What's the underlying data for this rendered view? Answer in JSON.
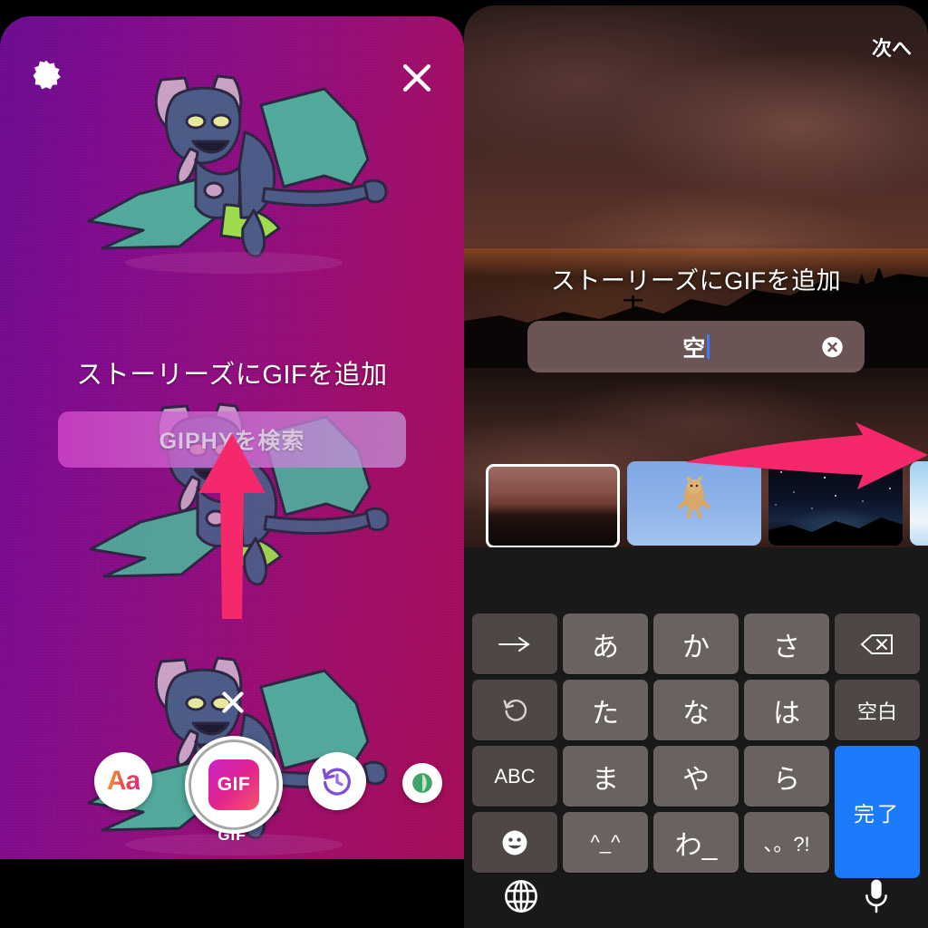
{
  "left_panel": {
    "gear_icon": "gear-icon",
    "close_icon": "close-icon",
    "headline": "ストーリーズにGIFを追加",
    "search_button_label": "GIPHYを検索",
    "sticker_delete_icon": "close-icon",
    "tools": [
      {
        "name": "text-tool",
        "icon": "Aa",
        "label": "Aa"
      },
      {
        "name": "gif-tool",
        "icon": "gif-chip",
        "label": "GIF",
        "selected": true
      },
      {
        "name": "history-tool",
        "icon": "history-clock-icon",
        "label": ""
      },
      {
        "name": "effects-tool",
        "icon": "leaf-icon",
        "label": ""
      }
    ],
    "bottom_label": "GIF",
    "annotation_arrow": "arrow-up",
    "colors": {
      "gradient_start": "#6b0a8f",
      "gradient_end": "#a50b56",
      "arrow": "#f4286a"
    }
  },
  "right_panel": {
    "next_button_label": "次へ",
    "headline": "ストーリーズにGIFを追加",
    "search": {
      "value": "空",
      "placeholder": "GIPHYを検索",
      "clear_icon": "clear-circle-icon"
    },
    "thumbnails": [
      {
        "name": "thumb-sunset",
        "selected": true
      },
      {
        "name": "thumb-cat-sky",
        "selected": false
      },
      {
        "name": "thumb-starry-night",
        "selected": false
      },
      {
        "name": "thumb-clouds",
        "selected": false
      }
    ],
    "annotation_arrow": "arrow-right",
    "colors": {
      "arrow": "#f4286a",
      "done_key": "#1b7bfa"
    }
  },
  "keyboard": {
    "rows": [
      [
        {
          "label": "→",
          "name": "key-arrow-right",
          "type": "fn"
        },
        {
          "label": "あ",
          "name": "key-a",
          "type": "char"
        },
        {
          "label": "か",
          "name": "key-ka",
          "type": "char"
        },
        {
          "label": "さ",
          "name": "key-sa",
          "type": "char"
        },
        {
          "label": "⌫",
          "name": "key-backspace",
          "type": "fn"
        }
      ],
      [
        {
          "label": "↺",
          "name": "key-undo",
          "type": "fn"
        },
        {
          "label": "た",
          "name": "key-ta",
          "type": "char"
        },
        {
          "label": "な",
          "name": "key-na",
          "type": "char"
        },
        {
          "label": "は",
          "name": "key-ha",
          "type": "char"
        },
        {
          "label": "空白",
          "name": "key-space",
          "type": "fn"
        }
      ],
      [
        {
          "label": "ABC",
          "name": "key-abc",
          "type": "fn"
        },
        {
          "label": "ま",
          "name": "key-ma",
          "type": "char"
        },
        {
          "label": "や",
          "name": "key-ya",
          "type": "char"
        },
        {
          "label": "ら",
          "name": "key-ra",
          "type": "char"
        },
        {
          "label": "完了",
          "name": "key-done",
          "type": "done"
        }
      ],
      [
        {
          "label": "☻",
          "name": "key-emoji",
          "type": "fn"
        },
        {
          "label": "^_^",
          "name": "key-kaomoji",
          "type": "small"
        },
        {
          "label": "わ_",
          "name": "key-wa",
          "type": "char"
        },
        {
          "label": "、。?!",
          "name": "key-punct",
          "type": "small"
        },
        {
          "label": "",
          "name": "key-done-spacer",
          "type": "done-spacer"
        }
      ]
    ],
    "globe_icon": "globe-icon",
    "mic_icon": "microphone-icon"
  }
}
